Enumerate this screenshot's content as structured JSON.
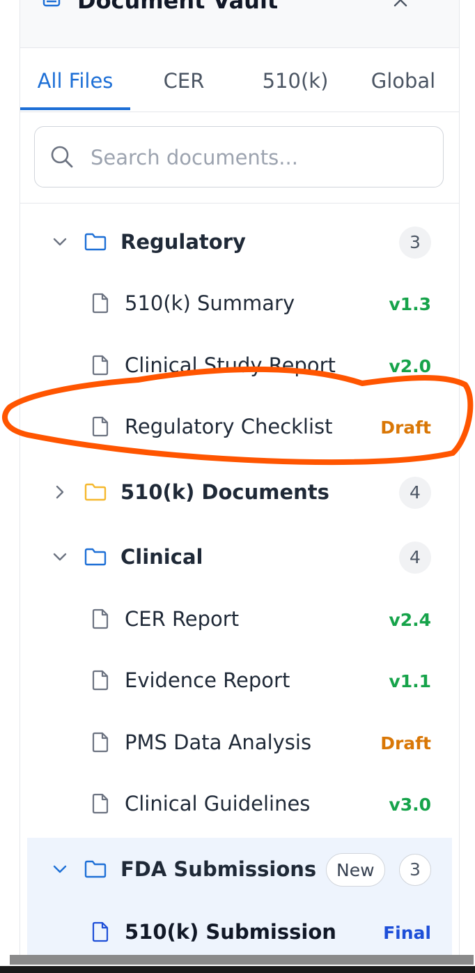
{
  "header": {
    "title": "Document Vault",
    "vault_icon": "drive-icon",
    "close_icon": "close-icon"
  },
  "tabs": [
    {
      "label": "All Files",
      "active": true
    },
    {
      "label": "CER",
      "active": false
    },
    {
      "label": "510(k)",
      "active": false
    },
    {
      "label": "Global",
      "active": false
    }
  ],
  "search": {
    "placeholder": "Search documents...",
    "value": ""
  },
  "folders": [
    {
      "name": "Regulatory",
      "count": "3",
      "expanded": true,
      "icon_color": "#1d6fd6",
      "files": [
        {
          "name": "510(k) Summary",
          "version": "v1.3",
          "status_color": "#16a34a"
        },
        {
          "name": "Clinical Study Report",
          "version": "v2.0",
          "status_color": "#16a34a"
        },
        {
          "name": "Regulatory Checklist",
          "version": "Draft",
          "status_color": "#d97706"
        }
      ]
    },
    {
      "name": "510(k) Documents",
      "count": "4",
      "expanded": false,
      "icon_color": "#f5b82e",
      "files": []
    },
    {
      "name": "Clinical",
      "count": "4",
      "expanded": true,
      "icon_color": "#1d6fd6",
      "files": [
        {
          "name": "CER Report",
          "version": "v2.4",
          "status_color": "#16a34a"
        },
        {
          "name": "Evidence Report",
          "version": "v1.1",
          "status_color": "#16a34a"
        },
        {
          "name": "PMS Data Analysis",
          "version": "Draft",
          "status_color": "#d97706"
        },
        {
          "name": "Clinical Guidelines",
          "version": "v3.0",
          "status_color": "#16a34a"
        }
      ]
    },
    {
      "name": "FDA Submissions",
      "badge": "New",
      "count": "3",
      "expanded": true,
      "selected": true,
      "icon_color": "#1d6fd6",
      "files": [
        {
          "name": "510(k) Submission",
          "version": "Final",
          "status_color": "#1d4ed8",
          "active": true
        }
      ]
    }
  ],
  "annotation": {
    "shape": "hand-drawn ellipse",
    "color": "#ff5500",
    "target": "Regulatory Checklist"
  }
}
